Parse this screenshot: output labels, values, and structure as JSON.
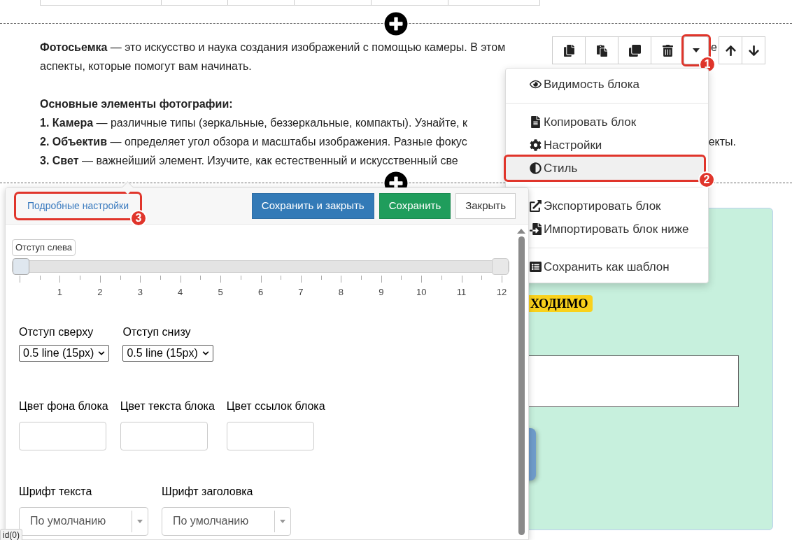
{
  "block_text": {
    "intro": [
      {
        "text": "**Фотосьемка** — это искусство и наука создания изображений с помощью камеры. В этом",
        "tail": "е"
      },
      {
        "text": "аспекты, которые помогут вам начинать."
      }
    ],
    "list": [
      {
        "text": "**Основные элементы фотографии:**"
      },
      {
        "text": "**1. Камера** — различные типы (зеркальные, беззеркальные, компакты). Узнайте, к"
      },
      {
        "text": "**2. Объектив** — определяет угол обзора и масштабы изображения. Разные фокус",
        "tail": "екты."
      },
      {
        "text": "**3. Свет** — важнейший элемент. Изучите, как естественный и искусственный све"
      }
    ]
  },
  "block_toolbar": {
    "buttons": [
      {
        "kind": "copy"
      },
      {
        "kind": "paste"
      },
      {
        "kind": "clone"
      },
      {
        "kind": "delete"
      },
      {
        "kind": "dropdown",
        "annotation": "1"
      },
      {
        "kind": "up"
      },
      {
        "kind": "down"
      }
    ]
  },
  "block_menu": {
    "items": [
      {
        "kind": "item",
        "label": "Видимость блока",
        "selected": false
      },
      {
        "kind": "divider"
      },
      {
        "kind": "item",
        "label": "Копировать блок",
        "selected": false
      },
      {
        "kind": "item",
        "label": "Настройки",
        "selected": false
      },
      {
        "kind": "item",
        "label": "Стиль",
        "selected": true,
        "annotation": "2"
      },
      {
        "kind": "divider"
      },
      {
        "kind": "item",
        "label": "Экспортировать блок",
        "selected": false
      },
      {
        "kind": "item",
        "label": "Импортировать блок ниже",
        "selected": false
      },
      {
        "kind": "divider"
      },
      {
        "kind": "item",
        "label": "Сохранить как шаблон",
        "selected": false
      }
    ]
  },
  "green_block": {
    "badge": "ХОДИМО"
  },
  "style_panel": {
    "advanced_link": {
      "label": "Подробные настройки",
      "annotation": "3"
    },
    "buttons": [
      {
        "label": "Сохранить и закрыть",
        "kind": "primary"
      },
      {
        "label": "Сохранить",
        "kind": "success"
      },
      {
        "label": "Закрыть",
        "kind": "default"
      }
    ],
    "slider": {
      "label": "Отступ слева",
      "level": 0,
      "scale": [
        "1",
        "2",
        "3",
        "4",
        "5",
        "6",
        "7",
        "8",
        "9",
        "10",
        "11",
        "12"
      ]
    },
    "spacing_selects": [
      {
        "label": "Отступ сверху",
        "value": "0.5 line (15px)"
      },
      {
        "label": "Отступ снизу",
        "value": "0.5 line (15px)"
      }
    ],
    "color_fields": [
      {
        "label": "Цвет фона блока"
      },
      {
        "label": "Цвет текста блока"
      },
      {
        "label": "Цвет ссылок блока"
      }
    ],
    "font_selects": [
      {
        "label": "Шрифт текста",
        "value": "По умолчанию"
      },
      {
        "label": "Шрифт заголовка",
        "value": "По умолчанию"
      }
    ]
  },
  "status_tooltip": "id(0)"
}
